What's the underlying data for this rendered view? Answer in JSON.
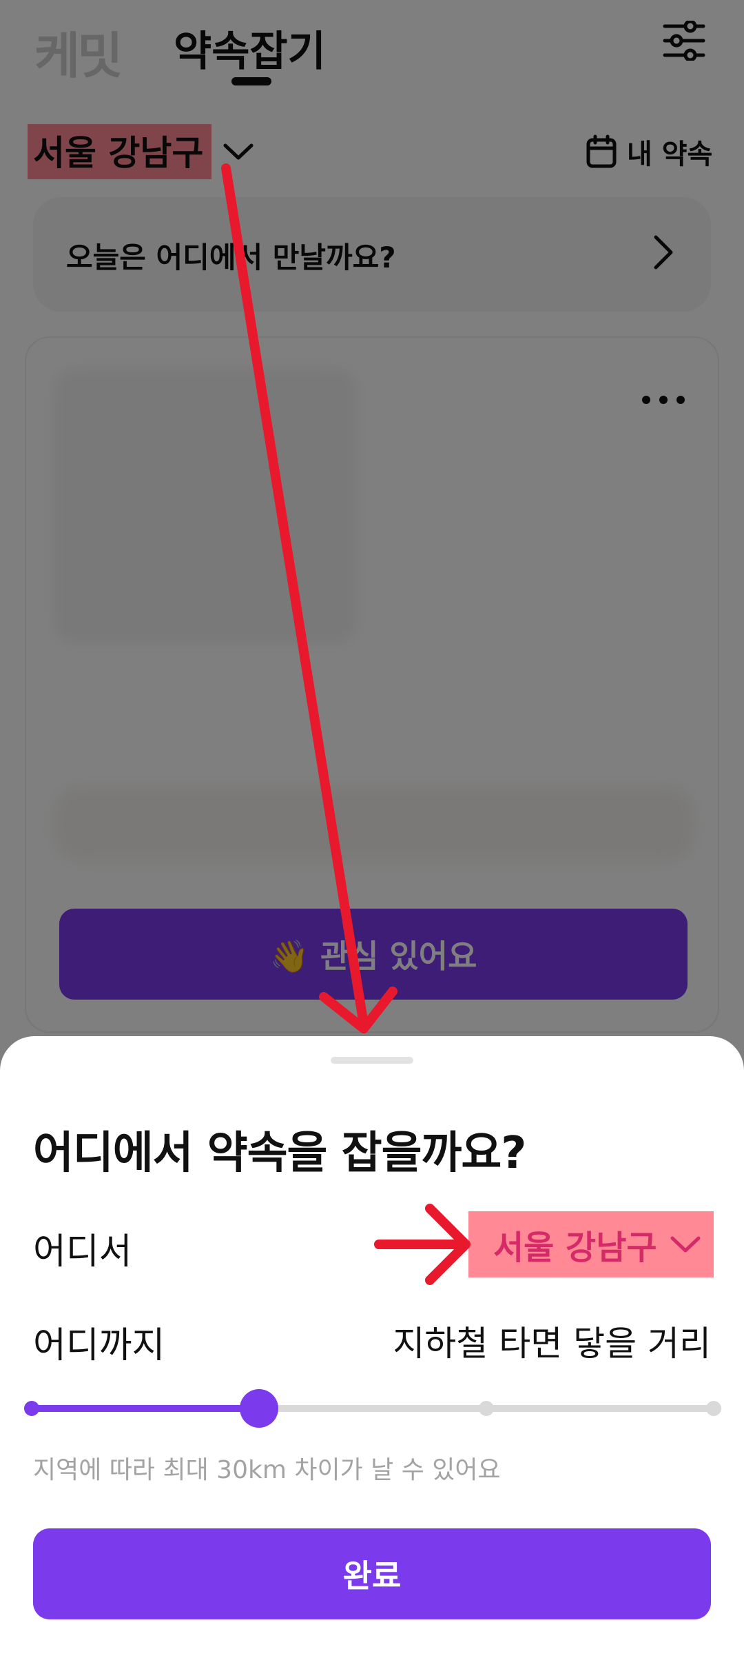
{
  "header": {
    "logo": "케밋",
    "tab_title": "약속잡기"
  },
  "location_bar": {
    "selected_region": "서울 강남구",
    "my_appointments_label": "내 약속"
  },
  "where_prompt": {
    "text": "오늘은 어디에서 만날까요?"
  },
  "feed_card": {
    "interest_button_label": "👋 관심 있어요"
  },
  "bottom_sheet": {
    "title": "어디에서 약속을 잡을까요?",
    "from_label": "어디서",
    "from_value": "서울 강남구",
    "to_label": "어디까지",
    "to_value": "지하철 타면 닿을 거리",
    "distance_slider": {
      "steps": 4,
      "selected_index": 1
    },
    "hint": "지역에 따라 최대 30km 차이가 날 수 있어요",
    "done_label": "완료"
  },
  "colors": {
    "accent": "#7c3aed",
    "highlight": "#ff8a95",
    "highlight_text": "#d62a68",
    "annotation_arrow": "#e8192c"
  },
  "icons": [
    "filter-icon",
    "calendar-icon",
    "chevron-down-icon",
    "chevron-right-icon",
    "more-icon"
  ]
}
